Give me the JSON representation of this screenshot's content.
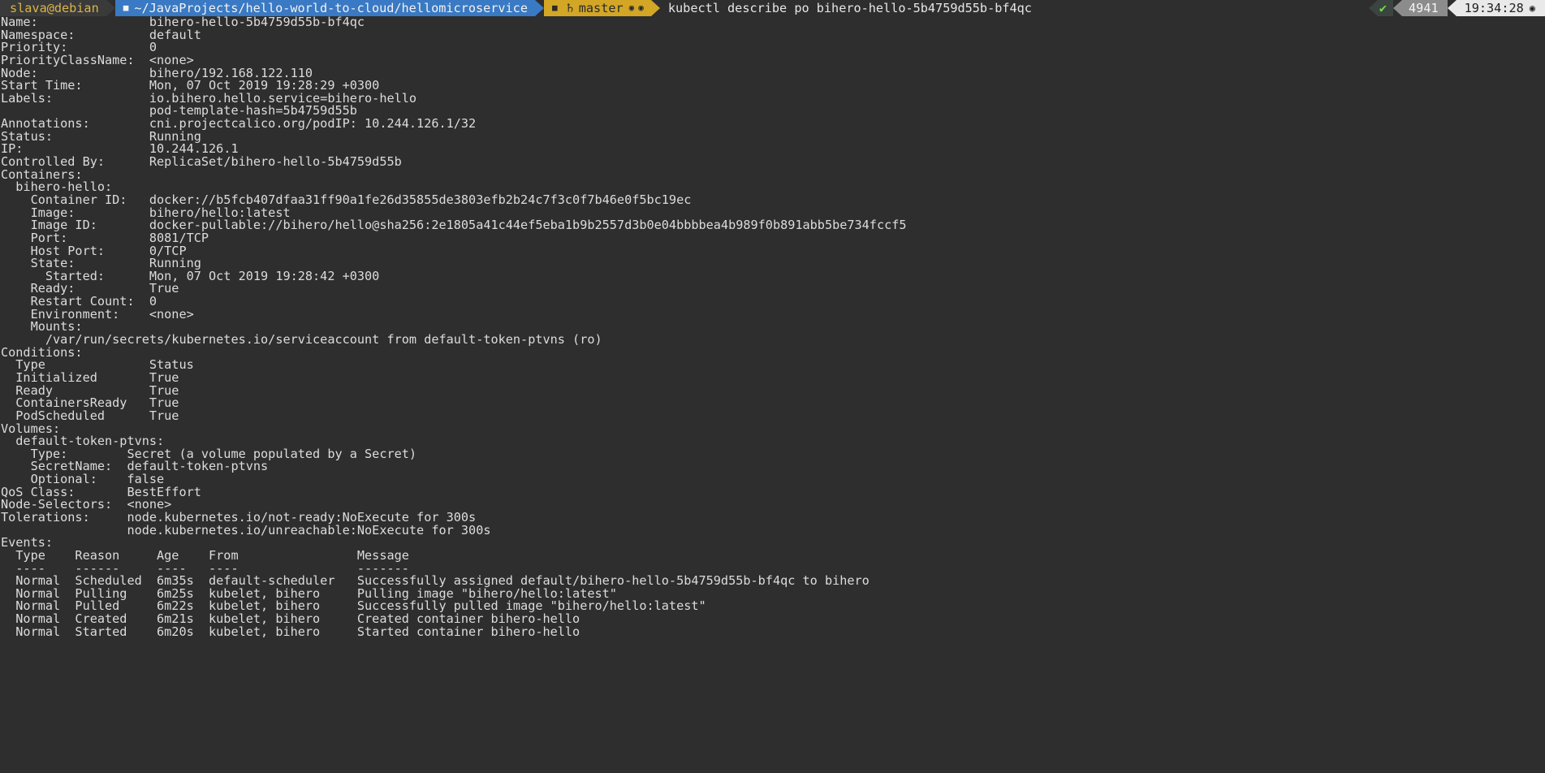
{
  "prompt": {
    "user_host": "slava@debian",
    "folder_icon": "folder-icon",
    "path": "~/JavaProjects/hello-world-to-cloud/hellomicroservice",
    "git_repo_icon": "repo-icon",
    "git_branch_icon": "git-branch-icon",
    "git_branch": "master",
    "git_status_icon_1": "circle-dot-icon",
    "git_status_icon_2": "circle-dot-icon",
    "command": "kubectl describe po bihero-hello-5b4759d55b-bf4qc",
    "exit_ok_icon": "check-icon",
    "exit_ok": "✔",
    "jobs": "4941",
    "time": "19:34:28",
    "clock_icon": "clock-icon",
    "clock_glyph": "○",
    "colors": {
      "user_bg": "#3a3a3a",
      "user_fg": "#d9b44a",
      "path_bg": "#3a79c3",
      "path_fg": "#f2f2f2",
      "git_bg": "#d3a625",
      "git_fg": "#2a2a2a",
      "ok_bg": "#3c4440",
      "ok_fg": "#6ddd4a",
      "jobs_bg": "#8c8c8c",
      "jobs_fg": "#f4f4f4",
      "time_bg": "#e9e9e9",
      "time_fg": "#1e1e1e",
      "terminal_bg": "#2e2e2e",
      "terminal_fg": "#dcdcdc"
    }
  },
  "output": {
    "lines": [
      "Name:               bihero-hello-5b4759d55b-bf4qc",
      "Namespace:          default",
      "Priority:           0",
      "PriorityClassName:  <none>",
      "Node:               bihero/192.168.122.110",
      "Start Time:         Mon, 07 Oct 2019 19:28:29 +0300",
      "Labels:             io.bihero.hello.service=bihero-hello",
      "                    pod-template-hash=5b4759d55b",
      "Annotations:        cni.projectcalico.org/podIP: 10.244.126.1/32",
      "Status:             Running",
      "IP:                 10.244.126.1",
      "Controlled By:      ReplicaSet/bihero-hello-5b4759d55b",
      "Containers:",
      "  bihero-hello:",
      "    Container ID:   docker://b5fcb407dfaa31ff90a1fe26d35855de3803efb2b24c7f3c0f7b46e0f5bc19ec",
      "    Image:          bihero/hello:latest",
      "    Image ID:       docker-pullable://bihero/hello@sha256:2e1805a41c44ef5eba1b9b2557d3b0e04bbbbea4b989f0b891abb5be734fccf5",
      "    Port:           8081/TCP",
      "    Host Port:      0/TCP",
      "    State:          Running",
      "      Started:      Mon, 07 Oct 2019 19:28:42 +0300",
      "    Ready:          True",
      "    Restart Count:  0",
      "    Environment:    <none>",
      "    Mounts:",
      "      /var/run/secrets/kubernetes.io/serviceaccount from default-token-ptvns (ro)",
      "Conditions:",
      "  Type              Status",
      "  Initialized       True",
      "  Ready             True",
      "  ContainersReady   True",
      "  PodScheduled      True",
      "Volumes:",
      "  default-token-ptvns:",
      "    Type:        Secret (a volume populated by a Secret)",
      "    SecretName:  default-token-ptvns",
      "    Optional:    false",
      "QoS Class:       BestEffort",
      "Node-Selectors:  <none>",
      "Tolerations:     node.kubernetes.io/not-ready:NoExecute for 300s",
      "                 node.kubernetes.io/unreachable:NoExecute for 300s",
      "Events:",
      "  Type    Reason     Age    From                Message",
      "  ----    ------     ----   ----                -------",
      "  Normal  Scheduled  6m35s  default-scheduler   Successfully assigned default/bihero-hello-5b4759d55b-bf4qc to bihero",
      "  Normal  Pulling    6m25s  kubelet, bihero     Pulling image \"bihero/hello:latest\"",
      "  Normal  Pulled     6m22s  kubelet, bihero     Successfully pulled image \"bihero/hello:latest\"",
      "  Normal  Created    6m21s  kubelet, bihero     Created container bihero-hello",
      "  Normal  Started    6m20s  kubelet, bihero     Started container bihero-hello"
    ]
  },
  "pod": {
    "name": "bihero-hello-5b4759d55b-bf4qc",
    "namespace": "default",
    "priority": "0",
    "priority_class_name": "<none>",
    "node": "bihero/192.168.122.110",
    "start_time": "Mon, 07 Oct 2019 19:28:29 +0300",
    "labels": [
      "io.bihero.hello.service=bihero-hello",
      "pod-template-hash=5b4759d55b"
    ],
    "annotations": [
      "cni.projectcalico.org/podIP: 10.244.126.1/32"
    ],
    "status": "Running",
    "ip": "10.244.126.1",
    "controlled_by": "ReplicaSet/bihero-hello-5b4759d55b",
    "containers": [
      {
        "name": "bihero-hello",
        "container_id": "docker://b5fcb407dfaa31ff90a1fe26d35855de3803efb2b24c7f3c0f7b46e0f5bc19ec",
        "image": "bihero/hello:latest",
        "image_id": "docker-pullable://bihero/hello@sha256:2e1805a41c44ef5eba1b9b2557d3b0e04bbbbea4b989f0b891abb5be734fccf5",
        "port": "8081/TCP",
        "host_port": "0/TCP",
        "state": "Running",
        "started": "Mon, 07 Oct 2019 19:28:42 +0300",
        "ready": "True",
        "restart_count": "0",
        "environment": "<none>",
        "mounts": [
          "/var/run/secrets/kubernetes.io/serviceaccount from default-token-ptvns (ro)"
        ]
      }
    ],
    "conditions": {
      "headers": [
        "Type",
        "Status"
      ],
      "rows": [
        [
          "Initialized",
          "True"
        ],
        [
          "Ready",
          "True"
        ],
        [
          "ContainersReady",
          "True"
        ],
        [
          "PodScheduled",
          "True"
        ]
      ]
    },
    "volumes": [
      {
        "name": "default-token-ptvns",
        "type": "Secret (a volume populated by a Secret)",
        "secret_name": "default-token-ptvns",
        "optional": "false"
      }
    ],
    "qos_class": "BestEffort",
    "node_selectors": "<none>",
    "tolerations": [
      "node.kubernetes.io/not-ready:NoExecute for 300s",
      "node.kubernetes.io/unreachable:NoExecute for 300s"
    ],
    "events": {
      "headers": [
        "Type",
        "Reason",
        "Age",
        "From",
        "Message"
      ],
      "rows": [
        [
          "Normal",
          "Scheduled",
          "6m35s",
          "default-scheduler",
          "Successfully assigned default/bihero-hello-5b4759d55b-bf4qc to bihero"
        ],
        [
          "Normal",
          "Pulling",
          "6m25s",
          "kubelet, bihero",
          "Pulling image \"bihero/hello:latest\""
        ],
        [
          "Normal",
          "Pulled",
          "6m22s",
          "kubelet, bihero",
          "Successfully pulled image \"bihero/hello:latest\""
        ],
        [
          "Normal",
          "Created",
          "6m21s",
          "kubelet, bihero",
          "Created container bihero-hello"
        ],
        [
          "Normal",
          "Started",
          "6m20s",
          "kubelet, bihero",
          "Started container bihero-hello"
        ]
      ]
    }
  }
}
